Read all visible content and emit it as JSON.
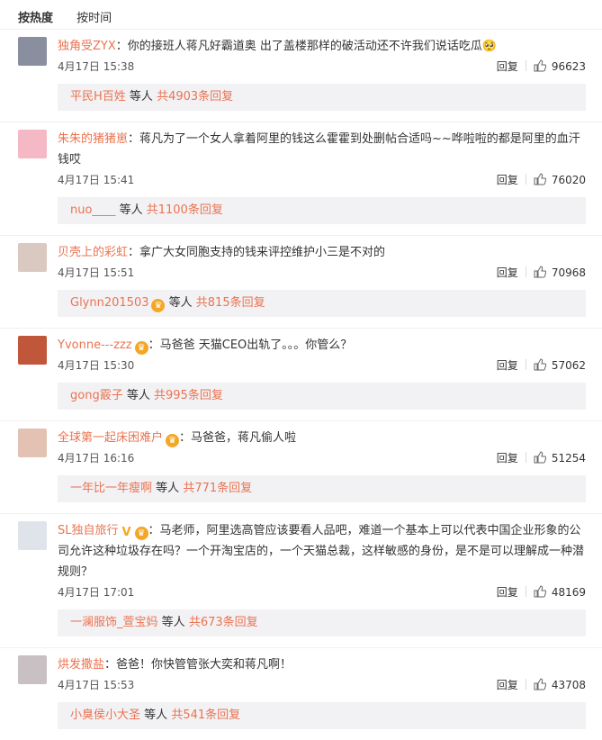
{
  "tabs": [
    {
      "label": "按热度",
      "active": true
    },
    {
      "label": "按时间",
      "active": false
    }
  ],
  "actions": {
    "reply": "回复"
  },
  "sub_wording": {
    "and_others": "等人"
  },
  "comments": [
    {
      "user": "独角受ZYX",
      "badges": [],
      "text": "：你的接班人蒋凡好霸道奥 出了盖楼那样的破活动还不许我们说话吃瓜🥺",
      "time": "4月17日 15:38",
      "likes": "96623",
      "sub_user": "平民H百姓",
      "sub_badges": [],
      "sub_count": "共4903条回复",
      "avatar_color": "#8a8fa0"
    },
    {
      "user": "朱朱的猪猪崽",
      "badges": [],
      "text": "：蒋凡为了一个女人拿着阿里的钱这么霍霍到处删帖合适吗~~哗啦啦的都是阿里的血汗钱哎",
      "time": "4月17日 15:41",
      "likes": "76020",
      "sub_user": "nuo____",
      "sub_badges": [],
      "sub_count": "共1100条回复",
      "avatar_color": "#f4b9c4"
    },
    {
      "user": "贝壳上的彩虹",
      "badges": [],
      "text": "：拿广大女同胞支持的钱来评控维护小三是不对的",
      "time": "4月17日 15:51",
      "likes": "70968",
      "sub_user": "Glynn201503",
      "sub_badges": [
        "vip"
      ],
      "sub_count": "共815条回复",
      "avatar_color": "#d9c9c0"
    },
    {
      "user": "Yvonne---zzz",
      "badges": [
        "vip"
      ],
      "text": "：马爸爸  天猫CEO出轨了。。。你管么？",
      "time": "4月17日 15:30",
      "likes": "57062",
      "sub_user": "gong霰子",
      "sub_badges": [],
      "sub_count": "共995条回复",
      "avatar_color": "#c0563a"
    },
    {
      "user": "全球第一起床困难户",
      "badges": [
        "vip"
      ],
      "text": "：马爸爸，蒋凡偷人啦",
      "time": "4月17日 16:16",
      "likes": "51254",
      "sub_user": "一年比一年瘦啊",
      "sub_badges": [],
      "sub_count": "共771条回复",
      "avatar_color": "#e3c2b4"
    },
    {
      "user": "SL独自旅行",
      "badges": [
        "v",
        "vip"
      ],
      "text": "：马老师，阿里选高管应该要看人品吧，难道一个基本上可以代表中国企业形象的公司允许这种垃圾存在吗？一个开淘宝店的，一个天猫总裁，这样敏感的身份，是不是可以理解成一种潜规则？",
      "time": "4月17日 17:01",
      "likes": "48169",
      "sub_user": "一澜服饰_萱宝妈",
      "sub_badges": [],
      "sub_count": "共673条回复",
      "avatar_color": "#dfe4ea"
    },
    {
      "user": "烘发撒盐",
      "badges": [],
      "text": "：爸爸！你快管管张大奕和蒋凡啊！",
      "time": "4月17日 15:53",
      "likes": "43708",
      "sub_user": "小臭侯小大圣",
      "sub_badges": [],
      "sub_count": "共541条回复",
      "avatar_color": "#c9c0c4"
    }
  ]
}
